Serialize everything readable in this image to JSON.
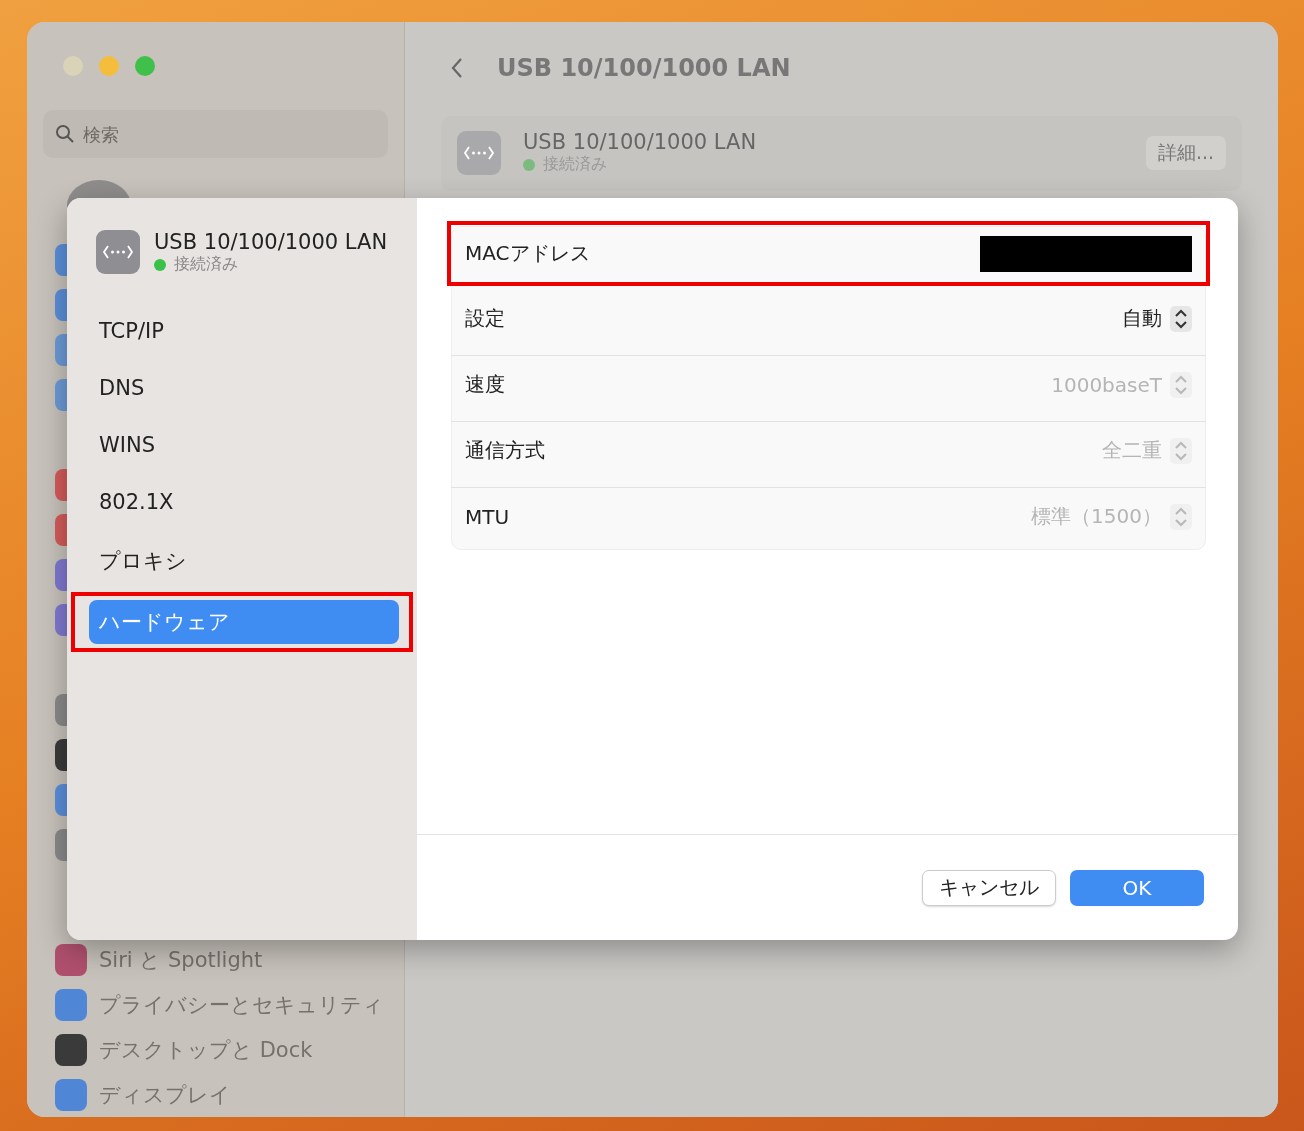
{
  "window": {
    "title": "USB 10/100/1000 LAN"
  },
  "search": {
    "placeholder": "検索"
  },
  "sidebar": {
    "items": [
      {
        "label": "Siri と Spotlight",
        "color": "#b0506e"
      },
      {
        "label": "プライバシーとセキュリティ",
        "color": "#4f86d6"
      },
      {
        "label": "デスクトップと Dock",
        "color": "#3a3a3a"
      },
      {
        "label": "ディスプレイ",
        "color": "#4f86d6"
      }
    ]
  },
  "service_card": {
    "name": "USB 10/100/1000 LAN",
    "status": "接続済み",
    "connected": true,
    "button": "詳細..."
  },
  "dialog": {
    "header": {
      "name": "USB 10/100/1000 LAN",
      "status": "接続済み",
      "connected": true
    },
    "nav": [
      {
        "label": "TCP/IP",
        "selected": false,
        "highlighted": false
      },
      {
        "label": "DNS",
        "selected": false,
        "highlighted": false
      },
      {
        "label": "WINS",
        "selected": false,
        "highlighted": false
      },
      {
        "label": "802.1X",
        "selected": false,
        "highlighted": false
      },
      {
        "label": "プロキシ",
        "selected": false,
        "highlighted": false
      },
      {
        "label": "ハードウェア",
        "selected": true,
        "highlighted": true
      }
    ],
    "rows": [
      {
        "kind": "redacted",
        "label": "MACアドレス",
        "highlighted": true
      },
      {
        "kind": "popup",
        "label": "設定",
        "value": "自動",
        "disabled": false,
        "highlighted": false
      },
      {
        "kind": "popup",
        "label": "速度",
        "value": "1000baseT",
        "disabled": true,
        "highlighted": false
      },
      {
        "kind": "popup",
        "label": "通信方式",
        "value": "全二重",
        "disabled": true,
        "highlighted": false
      },
      {
        "kind": "popup",
        "label": "MTU",
        "value": "標準（1500）",
        "disabled": true,
        "highlighted": false
      }
    ],
    "buttons": [
      {
        "label": "キャンセル",
        "kind": "secondary"
      },
      {
        "label": "OK",
        "kind": "primary"
      }
    ]
  }
}
